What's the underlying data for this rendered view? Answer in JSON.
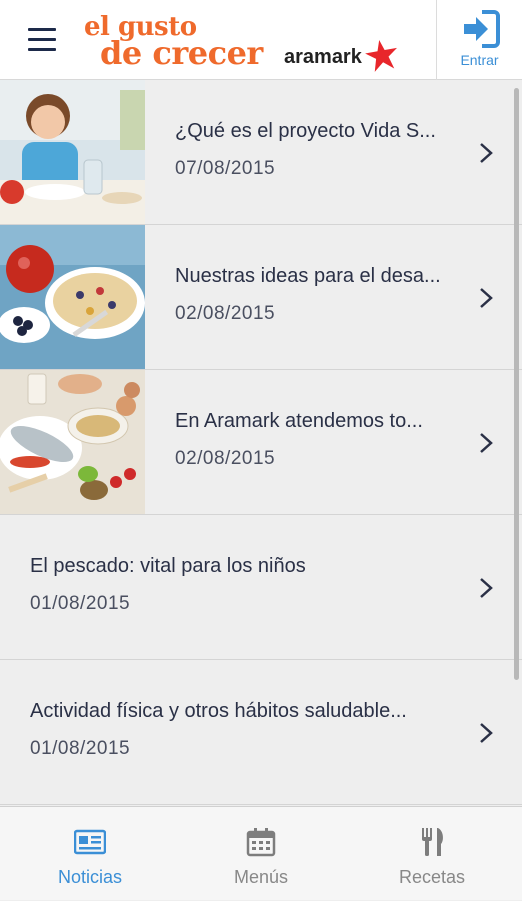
{
  "header": {
    "logo_line1": "el gusto",
    "logo_line2": "de crecer",
    "brand": "aramark",
    "login_label": "Entrar",
    "colors": {
      "accent": "#3b8fd6",
      "logo": "#ef6a2c",
      "star": "#e8262b"
    }
  },
  "news": [
    {
      "title": "¿Qué es el proyecto Vida S...",
      "date": "07/08/2015",
      "has_image": true,
      "image": "child-eating-photo"
    },
    {
      "title": "Nuestras ideas para el desa...",
      "date": "02/08/2015",
      "has_image": true,
      "image": "breakfast-bowls-photo"
    },
    {
      "title": "En Aramark atendemos to...",
      "date": "02/08/2015",
      "has_image": true,
      "image": "fish-and-legumes-photo"
    },
    {
      "title": "El pescado: vital para los niños",
      "date": "01/08/2015",
      "has_image": false
    },
    {
      "title": "Actividad física y otros hábitos saludable...",
      "date": "01/08/2015",
      "has_image": false
    }
  ],
  "tabs": [
    {
      "label": "Noticias",
      "icon": "newspaper-icon",
      "active": true
    },
    {
      "label": "Menús",
      "icon": "calendar-icon",
      "active": false
    },
    {
      "label": "Recetas",
      "icon": "fork-knife-icon",
      "active": false
    }
  ]
}
